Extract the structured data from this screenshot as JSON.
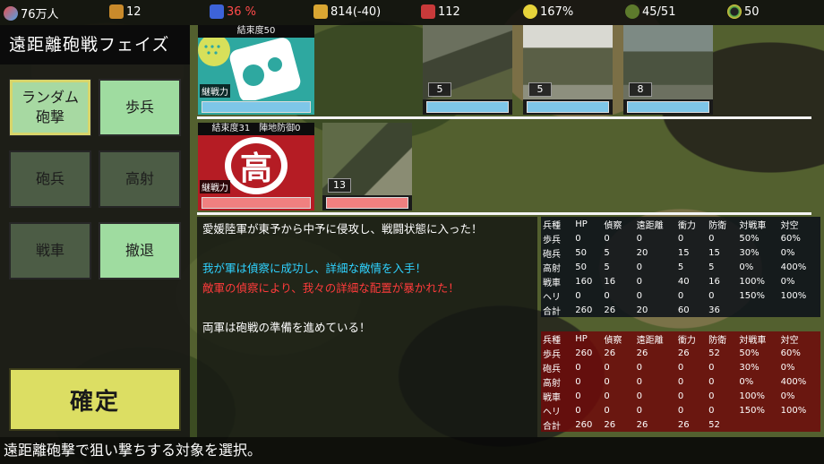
{
  "topbar": {
    "population": "76万人",
    "money": "12",
    "approval": "36 %",
    "supply": "814(-40)",
    "ammo": "112",
    "power": "167%",
    "troops": "45/51",
    "items": "50"
  },
  "phase": {
    "title": "遠距離砲戦フェイズ",
    "buttons": {
      "random": "ランダム\n砲撃",
      "infantry": "歩兵",
      "artillery": "砲兵",
      "antiair": "高射",
      "tank": "戦車",
      "retreat": "撤退"
    },
    "confirm": "確定"
  },
  "ally": {
    "header": "結束度50",
    "sustain_label": "継戦力",
    "units": [
      "5",
      "5",
      "8"
    ]
  },
  "enemy": {
    "header": "結束度31　陣地防御0",
    "sustain_label": "継戦力",
    "emblem": "高",
    "units": [
      "13"
    ]
  },
  "messages": [
    {
      "text": "愛媛陸軍が東予から中予に侵攻し、戦闘状態に入った！",
      "color": "#ffffff"
    },
    {
      "text": "",
      "color": "#ffffff"
    },
    {
      "text": "我が軍は偵察に成功し、詳細な敵情を入手！",
      "color": "#2fd2ff"
    },
    {
      "text": "敵軍の偵察により、我々の詳細な配置が暴かれた！",
      "color": "#ff3b3b"
    },
    {
      "text": "",
      "color": "#ffffff"
    },
    {
      "text": "両軍は砲戦の準備を進めている！",
      "color": "#ffffff"
    }
  ],
  "stats_headers": [
    "兵種",
    "HP",
    "偵察",
    "遠距離",
    "衝力",
    "防衛",
    "対戦車",
    "対空"
  ],
  "ally_stats": [
    [
      "歩兵",
      "0",
      "0",
      "0",
      "0",
      "0",
      "50%",
      "60%"
    ],
    [
      "砲兵",
      "50",
      "5",
      "20",
      "15",
      "15",
      "30%",
      "0%"
    ],
    [
      "高射",
      "50",
      "5",
      "0",
      "5",
      "5",
      "0%",
      "400%"
    ],
    [
      "戦車",
      "160",
      "16",
      "0",
      "40",
      "16",
      "100%",
      "0%"
    ],
    [
      "ヘリ",
      "0",
      "0",
      "0",
      "0",
      "0",
      "150%",
      "100%"
    ],
    [
      "合計",
      "260",
      "26",
      "20",
      "60",
      "36",
      "",
      ""
    ]
  ],
  "enemy_stats": [
    [
      "歩兵",
      "260",
      "26",
      "26",
      "26",
      "52",
      "50%",
      "60%"
    ],
    [
      "砲兵",
      "0",
      "0",
      "0",
      "0",
      "0",
      "30%",
      "0%"
    ],
    [
      "高射",
      "0",
      "0",
      "0",
      "0",
      "0",
      "0%",
      "400%"
    ],
    [
      "戦車",
      "0",
      "0",
      "0",
      "0",
      "0",
      "100%",
      "0%"
    ],
    [
      "ヘリ",
      "0",
      "0",
      "0",
      "0",
      "0",
      "150%",
      "100%"
    ],
    [
      "合計",
      "260",
      "26",
      "26",
      "26",
      "52",
      "",
      ""
    ]
  ],
  "status_line": "遠距離砲撃で狙い撃ちする対象を選択。",
  "colors": {
    "ally": "#2ea8a0",
    "enemy": "#b51c24",
    "button_on": "#9fdca0",
    "confirm": "#dcde63"
  }
}
